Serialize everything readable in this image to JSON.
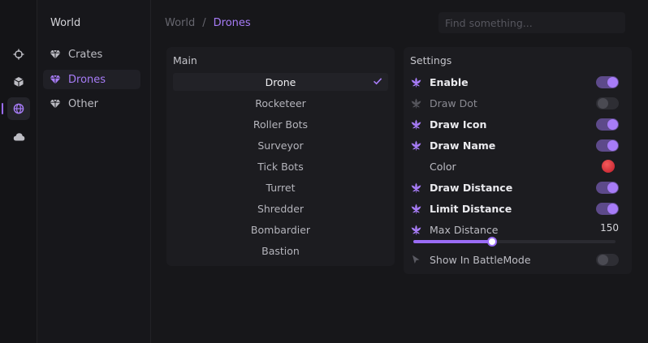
{
  "rail": {
    "items": [
      {
        "icon": "crosshair-icon"
      },
      {
        "icon": "cube-icon"
      },
      {
        "icon": "globe-icon",
        "active": true
      },
      {
        "icon": "cloud-icon"
      }
    ]
  },
  "sidebar": {
    "title": "World",
    "items": [
      {
        "label": "Crates"
      },
      {
        "label": "Drones",
        "active": true
      },
      {
        "label": "Other"
      }
    ]
  },
  "breadcrumb": {
    "root": "World",
    "separator": "/",
    "current": "Drones"
  },
  "search": {
    "placeholder": "Find something..."
  },
  "main": {
    "title": "Main",
    "items": [
      {
        "label": "Drone",
        "selected": true
      },
      {
        "label": "Rocketeer"
      },
      {
        "label": "Roller Bots"
      },
      {
        "label": "Surveyor"
      },
      {
        "label": "Tick Bots"
      },
      {
        "label": "Turret"
      },
      {
        "label": "Shredder"
      },
      {
        "label": "Bombardier"
      },
      {
        "label": "Bastion"
      }
    ]
  },
  "settings": {
    "title": "Settings",
    "rows": [
      {
        "label": "Enable",
        "icon": "leaf-icon",
        "toggle": true
      },
      {
        "label": "Draw Dot",
        "icon": "leaf-icon",
        "toggle": false
      },
      {
        "label": "Draw Icon",
        "icon": "leaf-icon",
        "toggle": true
      },
      {
        "label": "Draw Name",
        "icon": "leaf-icon",
        "toggle": true
      },
      {
        "label": "Color",
        "color": "#e0303c"
      },
      {
        "label": "Draw Distance",
        "icon": "leaf-icon",
        "toggle": true
      },
      {
        "label": "Limit Distance",
        "icon": "leaf-icon",
        "toggle": true
      }
    ],
    "max_distance": {
      "label": "Max Distance",
      "value": "150",
      "fraction": 0.39
    },
    "battle_mode": {
      "label": "Show In BattleMode",
      "icon": "cursor-icon",
      "toggle": false
    }
  },
  "colors": {
    "accent": "#a77cf7",
    "background": "#17171a",
    "panel": "#1c1c20"
  }
}
